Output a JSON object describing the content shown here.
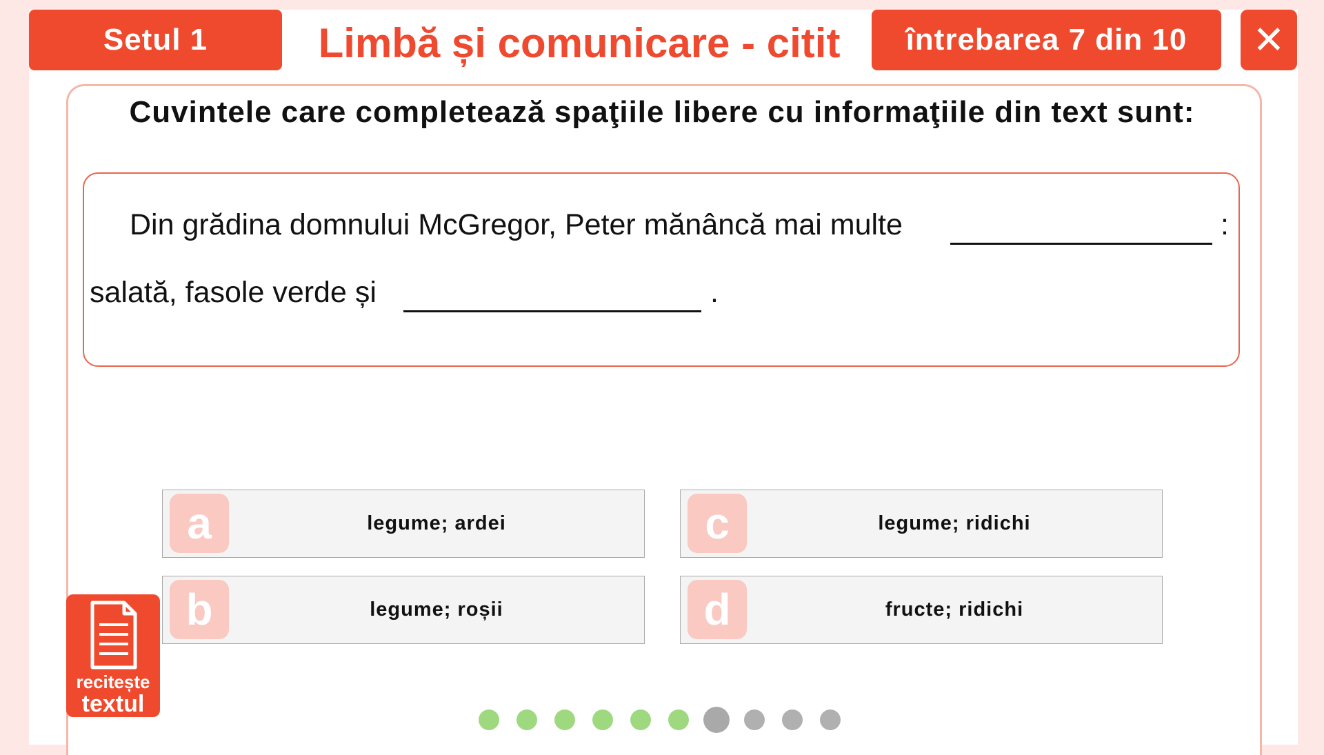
{
  "header": {
    "set_label": "Setul 1",
    "subject_title": "Limbă și comunicare - citit",
    "question_counter": "întrebarea 7 din 10",
    "close_glyph": "✕"
  },
  "question": {
    "prompt": "Cuvintele care completează spaţiile libere cu informaţiile din text sunt:",
    "text_line1": "Din grădina domnului McGregor, Peter mănâncă mai multe",
    "text_colon": ":",
    "text_line2": "salată, fasole verde și",
    "text_end": "."
  },
  "answers": [
    {
      "letter": "a",
      "label": "legume; ardei"
    },
    {
      "letter": "b",
      "label": "legume; roșii"
    },
    {
      "letter": "c",
      "label": "legume; ridichi"
    },
    {
      "letter": "d",
      "label": "fructe; ridichi"
    }
  ],
  "reread_button": {
    "line1": "recitește",
    "line2": "textul",
    "icon": "document-icon"
  },
  "progress": {
    "total": 10,
    "current": 7,
    "answered": 6,
    "colors": {
      "answered": "#9fd97f",
      "current": "#a9a9a9",
      "pending": "#b0b0b0"
    }
  },
  "colors": {
    "accent": "#f04a2e",
    "letter_badge": "#f9c9c2",
    "background": "#fde8e6"
  }
}
